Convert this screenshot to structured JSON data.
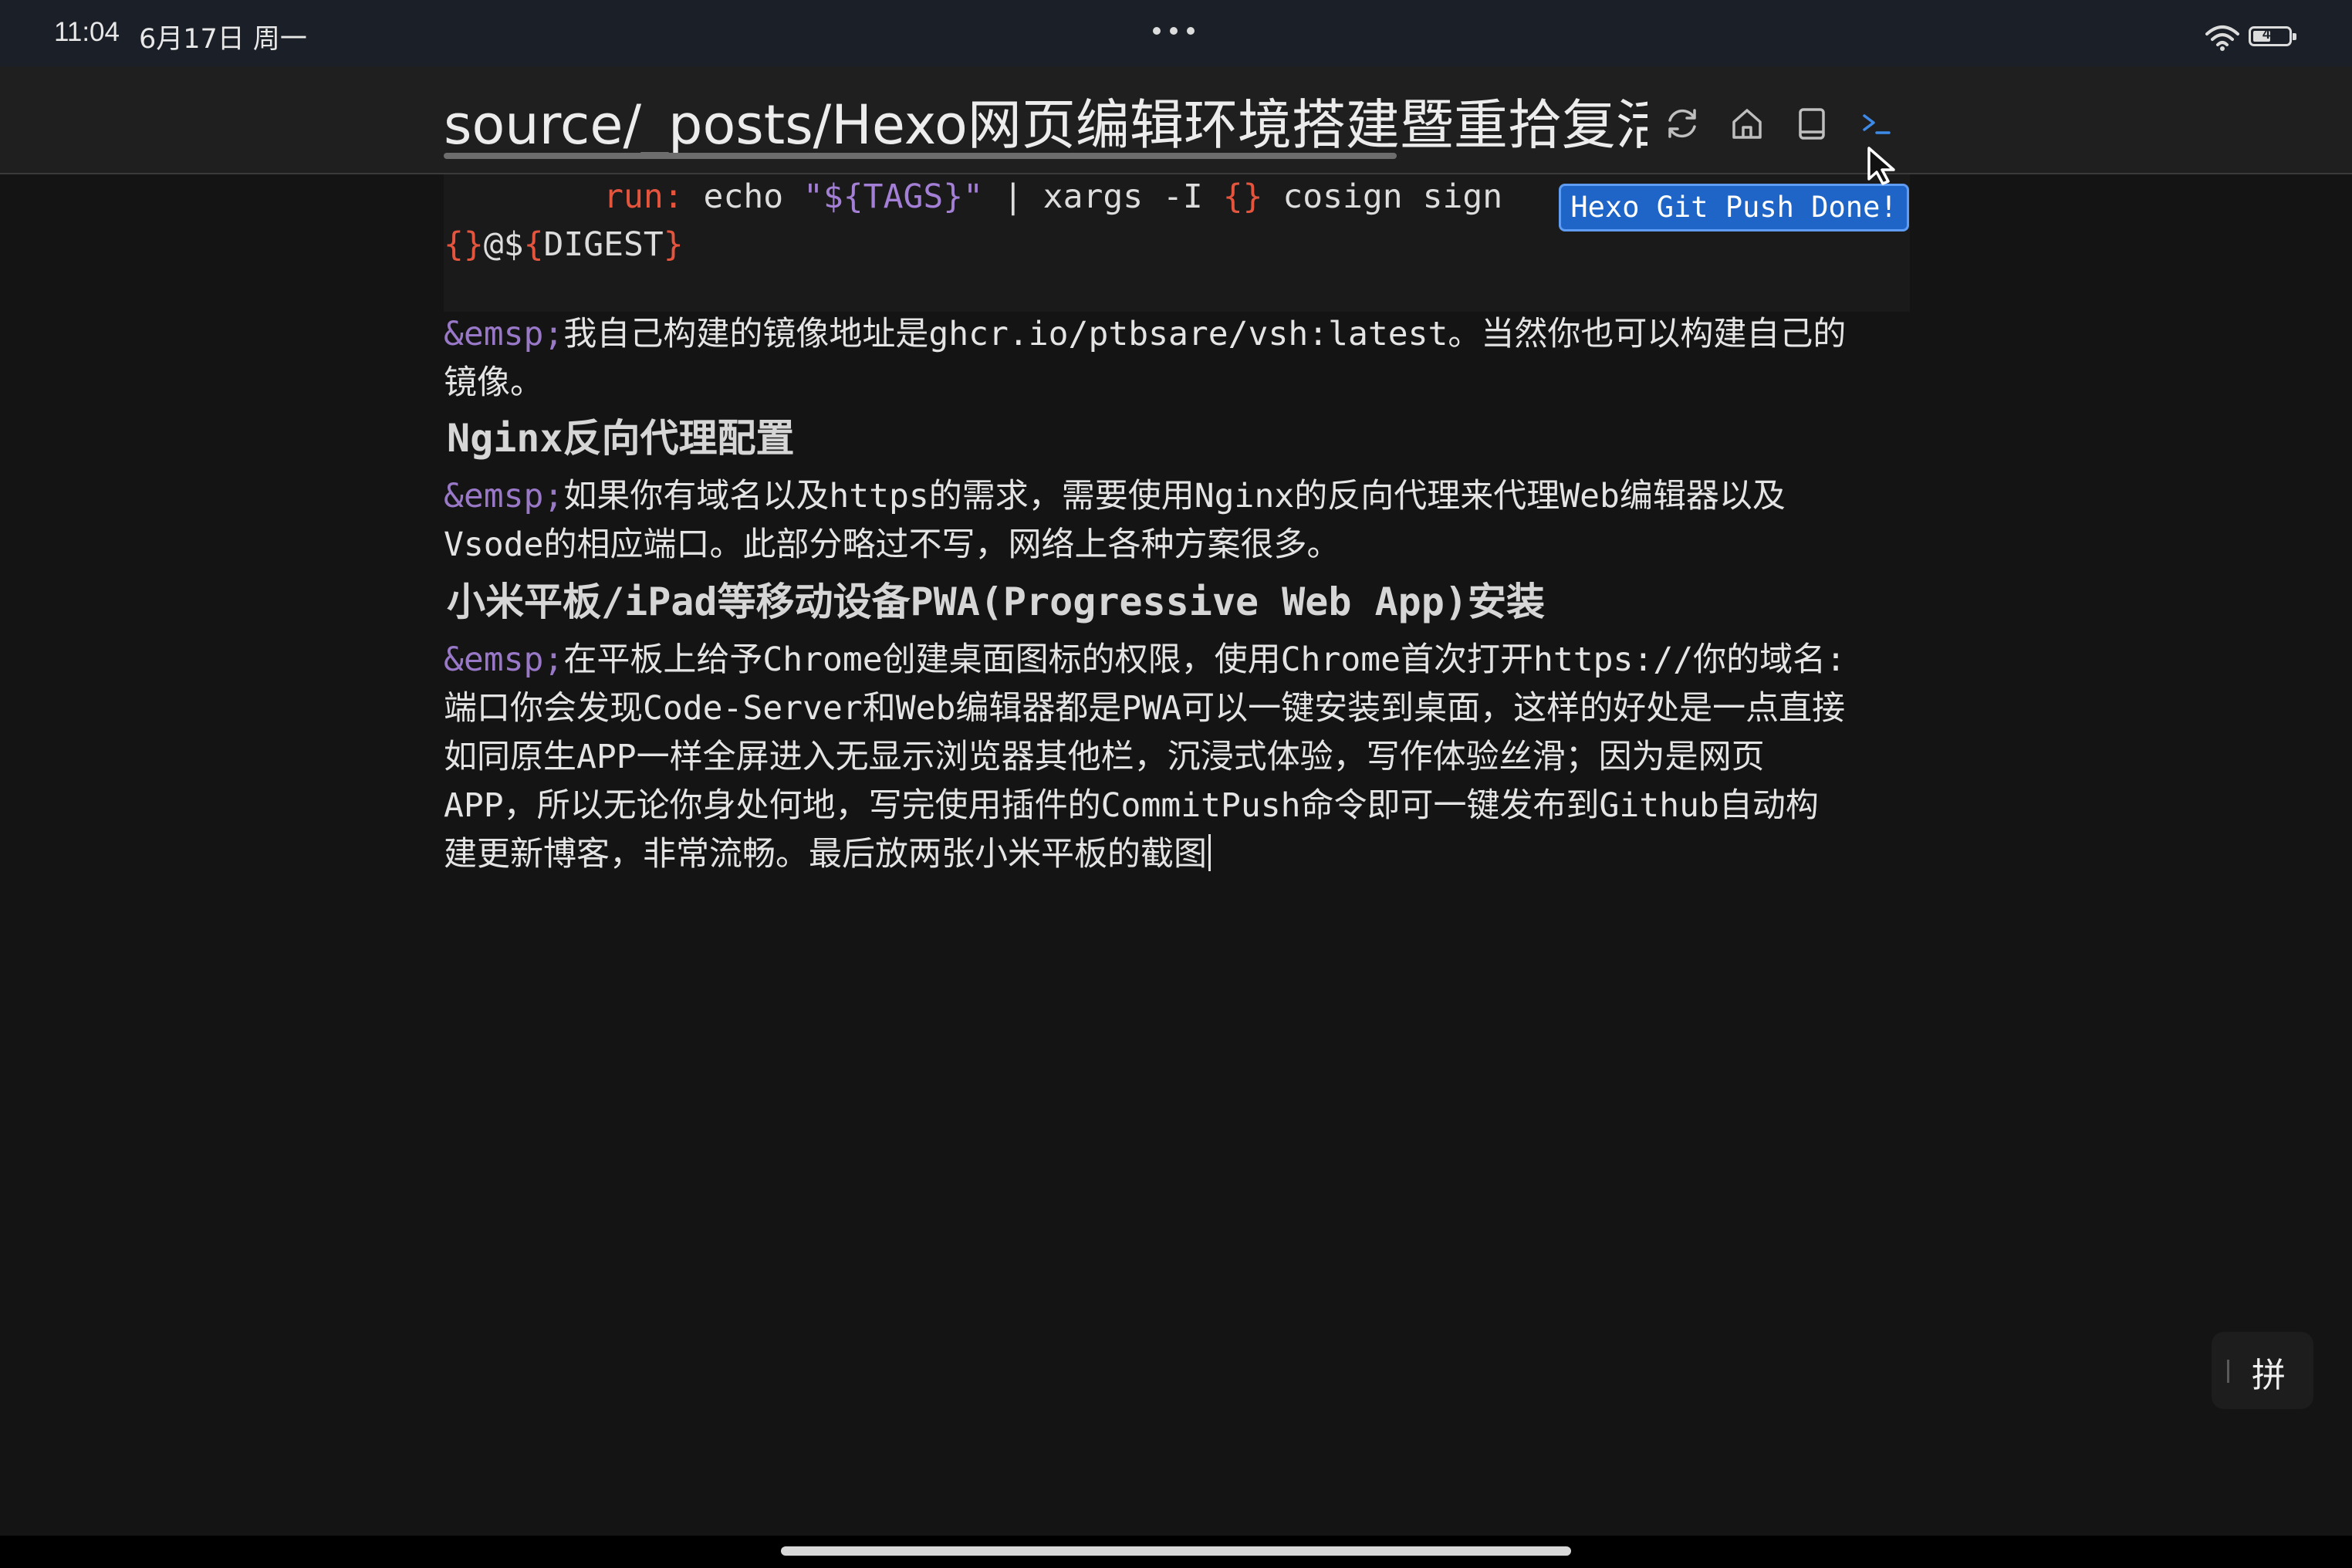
{
  "status_bar": {
    "time": "11:04",
    "date": "6月17日 周一",
    "battery": "44",
    "wifi_icon": "wifi-icon"
  },
  "title_bar": {
    "title": "source/_posts/Hexo网页编辑环境搭建暨重拾复活笔记.md",
    "buttons": [
      {
        "name": "refresh-icon"
      },
      {
        "name": "home-icon"
      },
      {
        "name": "book-icon"
      },
      {
        "name": "terminal-icon",
        "accent": "#3d8ae8"
      }
    ]
  },
  "toast": {
    "text": "Hexo Git Push Done!",
    "bg": "#1e65c7"
  },
  "editor": {
    "code_line1": {
      "indent": "        ",
      "key": "run:",
      "cmd1": " echo ",
      "str": "\"${TAGS}\"",
      "cmd2": " | xargs -I ",
      "brace": "{}",
      "cmd3": " cosign sign"
    },
    "code_line2": {
      "brace": "{}",
      "text1": "@$",
      "brace2": "{",
      "text2": "DIGEST",
      "brace3": "}"
    },
    "entity": "&emsp;",
    "p1": {
      "line1": "我自己构建的镜像地址是ghcr.io/ptbsare/vsh:latest。当然你也可以构建自己的",
      "line2": "镜像。"
    },
    "h1": "Nginx反向代理配置",
    "p2": {
      "line1": "如果你有域名以及https的需求，需要使用Nginx的反向代理来代理Web编辑器以及",
      "line2": "Vsode的相应端口。此部分略过不写，网络上各种方案很多。"
    },
    "h2": "小米平板/iPad等移动设备PWA(Progressive Web App)安装",
    "p3": {
      "line1": "在平板上给予Chrome创建桌面图标的权限，使用Chrome首次打开https://你的域名:",
      "line2": "端口你会发现Code-Server和Web编辑器都是PWA可以一键安装到桌面，这样的好处是一点直接",
      "line3": "如同原生APP一样全屏进入无显示浏览器其他栏，沉浸式体验，写作体验丝滑；因为是网页",
      "line4": "APP，所以无论你身处何地，写完使用插件的CommitPush命令即可一键发布到Github自动构",
      "line5": "建更新博客，非常流畅。最后放两张小米平板的截图"
    }
  },
  "ime": {
    "label": "拼"
  }
}
